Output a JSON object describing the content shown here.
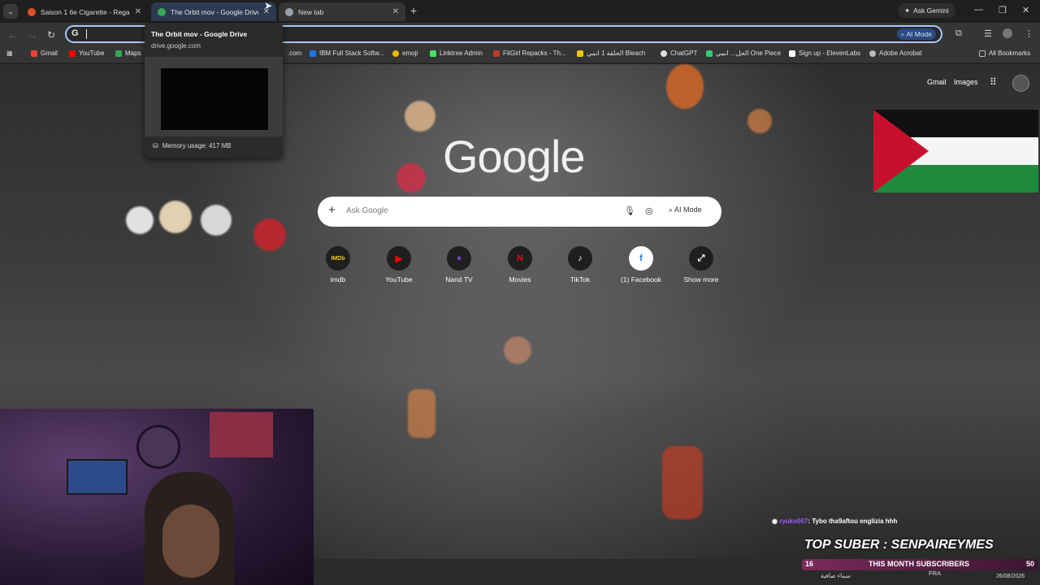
{
  "tabs": [
    {
      "title": "Saison 1 6e Cigarette - Regarde",
      "favicon_color": "#e0502a"
    },
    {
      "title": "The Orbit mov - Google Drive",
      "favicon_color": "#34a853"
    },
    {
      "title": "New tab",
      "favicon_color": "#9aa0a6"
    }
  ],
  "ask_gemini": "Ask Gemini",
  "omnibox": {
    "value": "",
    "ai_mode_label": "AI Mode"
  },
  "bookmarks": [
    {
      "label": "Gmail",
      "color": "#ea4335"
    },
    {
      "label": "YouTube",
      "color": "#ff0000"
    },
    {
      "label": "Maps",
      "color": "#34a853"
    },
    {
      "label": ".com",
      "color": "#777777"
    },
    {
      "label": "IBM Full Stack Softw...",
      "color": "#1a73e8"
    },
    {
      "label": "emoji",
      "color": "#f4b400"
    },
    {
      "label": "Linktree Admin",
      "color": "#43e660"
    },
    {
      "label": "FitGirl Repacks - Th...",
      "color": "#c0392b"
    },
    {
      "label": "الحلقة 1 انمي Bleach",
      "color": "#f1c40f"
    },
    {
      "label": "ChatGPT",
      "color": "#dddddd"
    },
    {
      "label": "الحل... انمي One Piece",
      "color": "#2ecc71"
    },
    {
      "label": "Sign up - ElevenLabs",
      "color": "#ffffff"
    },
    {
      "label": "Adobe Acrobat",
      "color": "#bbbbbb"
    },
    {
      "label": "All Bookmarks",
      "color": "#bbbbbb"
    }
  ],
  "hovercard": {
    "title": "The Orbit mov - Google Drive",
    "url": "drive.google.com",
    "memory": "Memory usage: 417 MB"
  },
  "ntp": {
    "links": {
      "gmail": "Gmail",
      "images": "Images"
    },
    "logo": "Google",
    "search_placeholder": "Ask Google",
    "ai_mode": "AI Mode",
    "shortcuts": [
      {
        "label": "imdb",
        "icon": "IMDb",
        "color": "#f5c518"
      },
      {
        "label": "YouTube",
        "icon": "▶",
        "color": "#ff0000"
      },
      {
        "label": "Nand TV",
        "icon": "♦",
        "color": "#7b3fe4"
      },
      {
        "label": "Movies",
        "icon": "N",
        "color": "#e50914"
      },
      {
        "label": "TikTok",
        "icon": "♪",
        "color": "#ffffff"
      },
      {
        "label": "(1) Facebook",
        "icon": "f",
        "color": "#1877f2"
      },
      {
        "label": "Show more",
        "icon": "⤢",
        "color": "#ffffff"
      }
    ]
  },
  "stream": {
    "chat_user": "ryuko007",
    "chat_message": ": Tybo tha9aftou englizia hhh",
    "top_sub": "TOP SUBER : SENPAIREYMES",
    "sub_count": "16",
    "sub_label": "THIS MONTH SUBSCRIBERS",
    "sub_goal": "50"
  },
  "taskbar": {
    "weather": "سماء صافية",
    "lang": "FRA",
    "time": "02:35",
    "date": "26/08/2026"
  }
}
